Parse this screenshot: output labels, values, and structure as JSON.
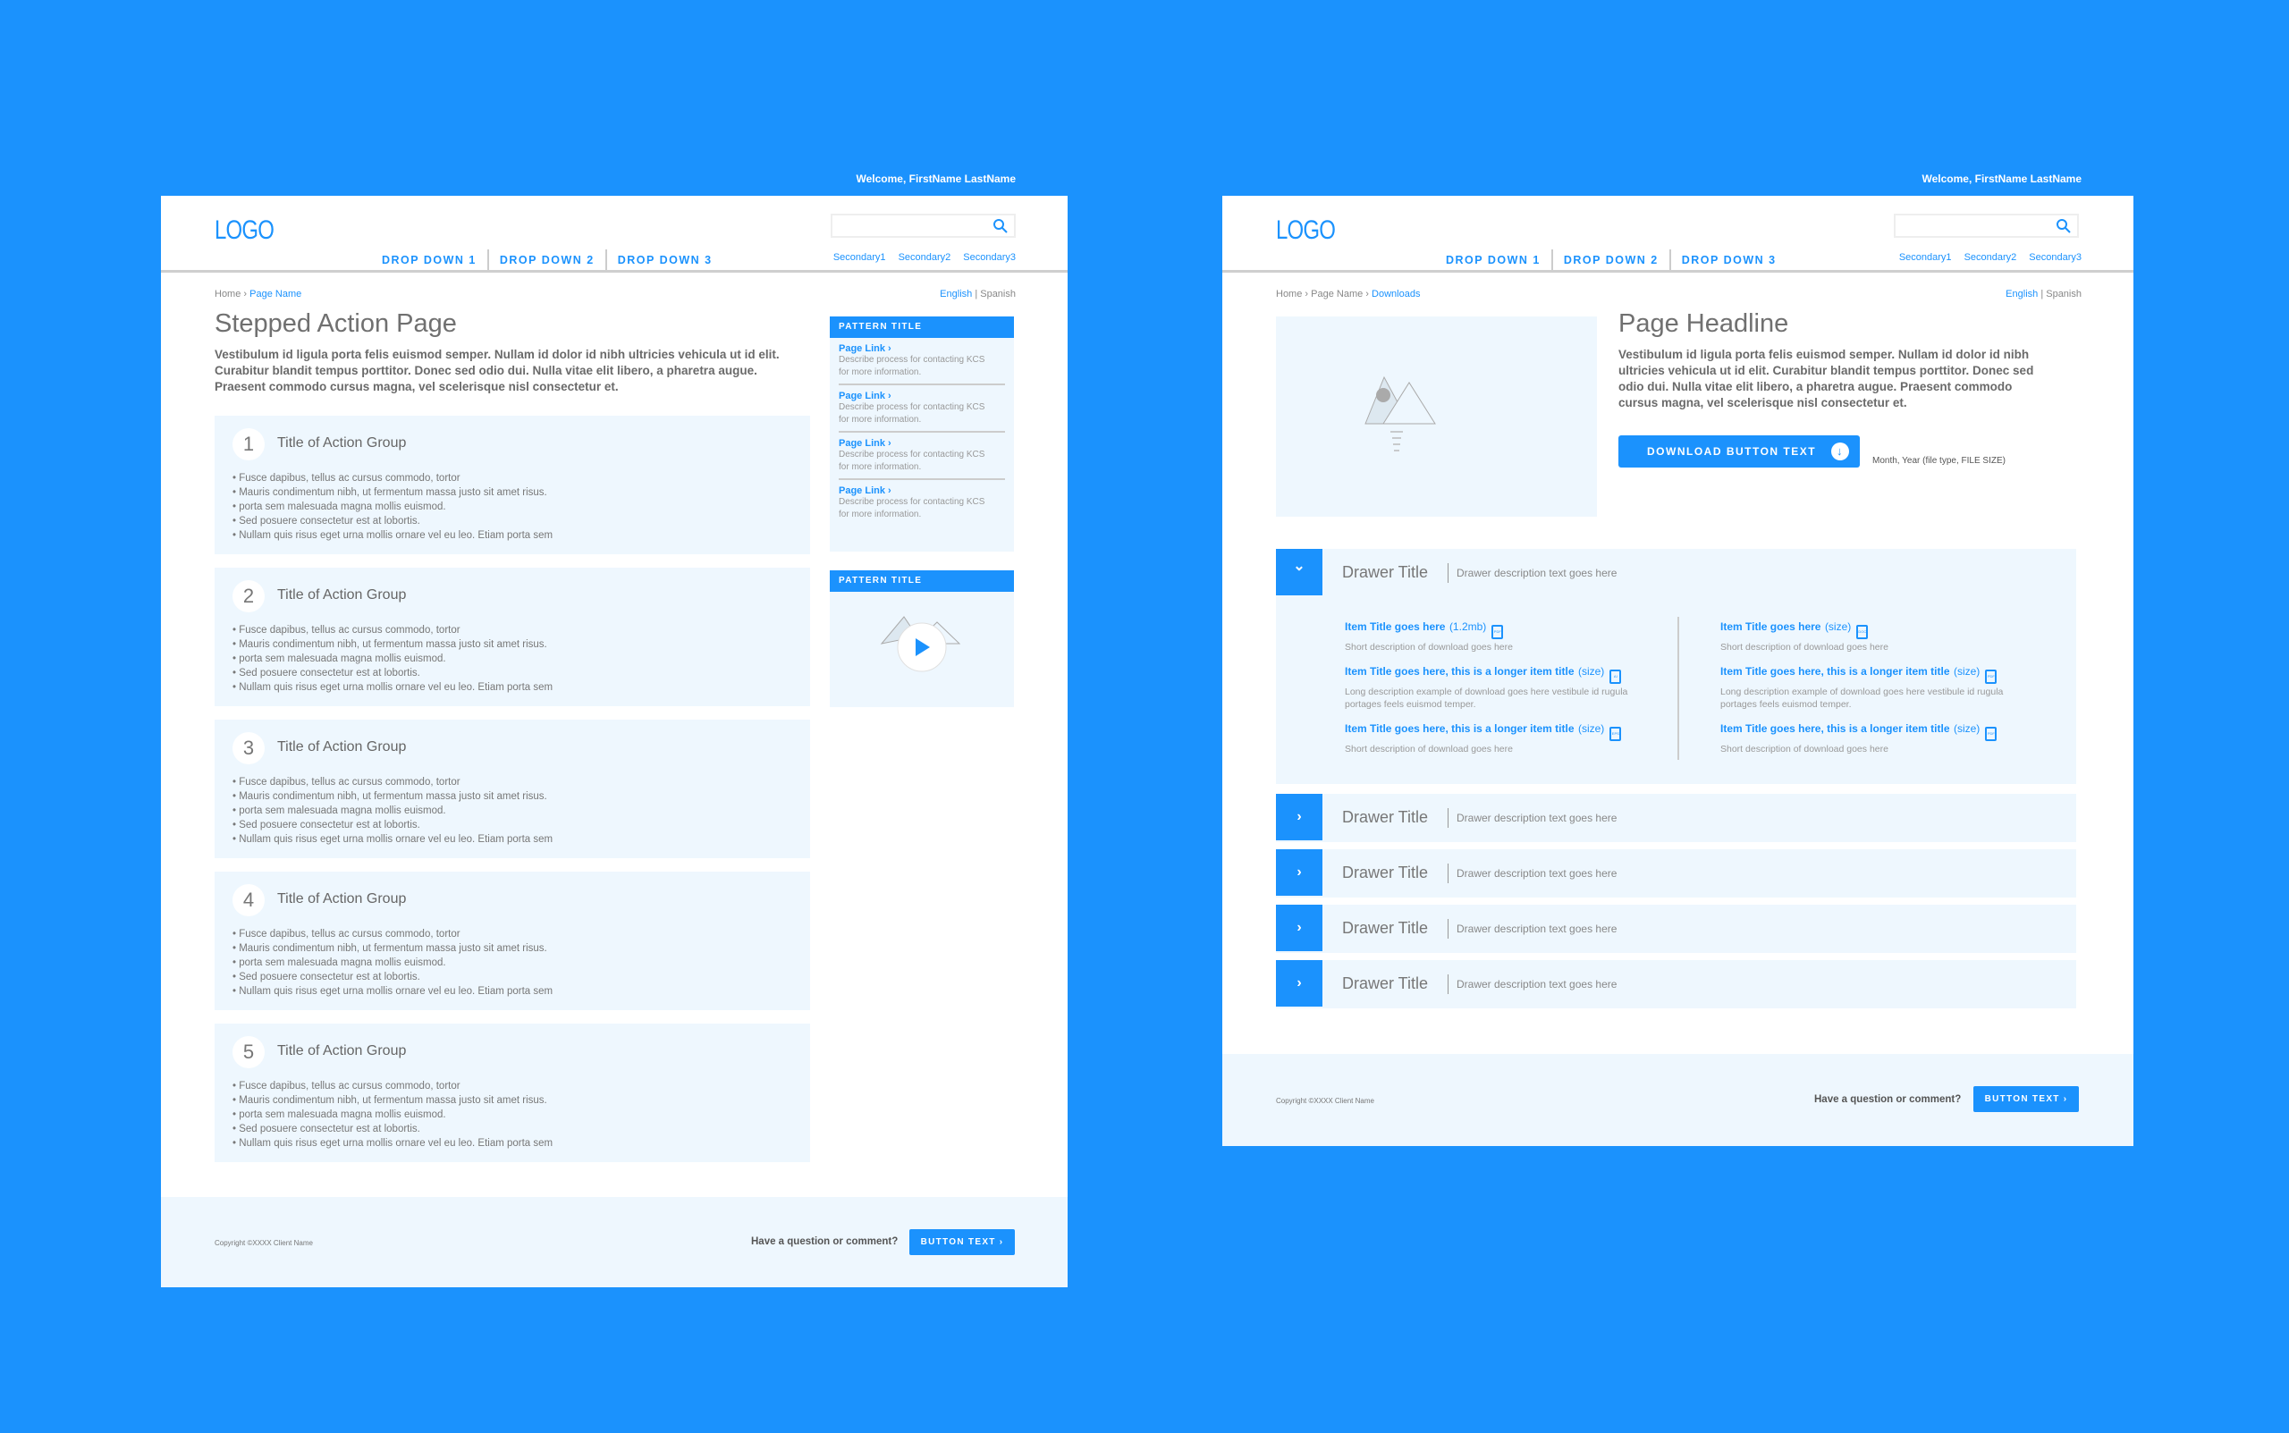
{
  "colors": {
    "accent": "#1b92fd",
    "panel": "#eef7fe"
  },
  "header": {
    "welcome": "Welcome, FirstName LastName",
    "logo": "LOGO",
    "nav": [
      "DROP DOWN 1",
      "DROP DOWN 2",
      "DROP DOWN 3"
    ],
    "secondary": [
      "Secondary1",
      "Secondary2",
      "Secondary3"
    ],
    "search_icon": "search-icon",
    "lang": {
      "english": "English",
      "sep": "|",
      "spanish": "Spanish"
    }
  },
  "left": {
    "breadcrumb": {
      "home": "Home",
      "sep": "›",
      "current": "Page Name"
    },
    "title": "Stepped Action Page",
    "intro": [
      "Vestibulum id ligula porta felis euismod semper. Nullam id dolor id nibh ultricies vehicula ut id elit.",
      "Curabitur blandit tempus porttitor. Donec sed odio dui. Nulla vitae elit libero, a pharetra augue.",
      "Praesent commodo cursus magna, vel scelerisque nisl consectetur et."
    ],
    "groups": [
      {
        "num": "1",
        "title": "Title of Action Group"
      },
      {
        "num": "2",
        "title": "Title of Action Group"
      },
      {
        "num": "3",
        "title": "Title of Action Group"
      },
      {
        "num": "4",
        "title": "Title of Action Group"
      },
      {
        "num": "5",
        "title": "Title of Action Group"
      }
    ],
    "group_bullets": [
      "• Fusce dapibus, tellus ac cursus commodo, tortor",
      "• Mauris condimentum nibh, ut fermentum massa justo sit amet risus.",
      "• porta sem malesuada magna mollis euismod.",
      "• Sed posuere consectetur est at lobortis.",
      "• Nullam quis risus eget urna mollis ornare vel eu leo. Etiam porta sem"
    ],
    "pattern1": {
      "title": "PATTERN TITLE",
      "links": [
        {
          "label": "Page Link ›",
          "desc": "Describe process for contacting KCS for more information."
        },
        {
          "label": "Page Link ›",
          "desc": "Describe process for contacting KCS for more information."
        },
        {
          "label": "Page Link ›",
          "desc": "Describe process for contacting KCS for more information."
        },
        {
          "label": "Page Link ›",
          "desc": "Describe process for contacting KCS for more information."
        }
      ]
    },
    "pattern2": {
      "title": "PATTERN TITLE",
      "icon": "play-icon"
    },
    "footer": {
      "copyright": "Copyright ©XXXX Client Name",
      "question": "Have a question or comment?",
      "button": "BUTTON TEXT ›"
    }
  },
  "right": {
    "breadcrumb": {
      "home": "Home",
      "sep": "›",
      "parent": "Page Name",
      "current": "Downloads"
    },
    "title": "Page Headline",
    "intro": [
      "Vestibulum id ligula porta felis euismod semper. Nullam id dolor id nibh",
      "ultricies vehicula ut id elit. Curabitur blandit tempus porttitor. Donec sed",
      "odio dui. Nulla vitae elit libero, a pharetra augue. Praesent commodo",
      "cursus magna, vel scelerisque nisl consectetur et."
    ],
    "download": {
      "label": "DOWNLOAD BUTTON TEXT",
      "icon": "download-icon",
      "meta": "Month, Year (file type, FILE SIZE)"
    },
    "drawers": [
      {
        "title": "Drawer Title",
        "desc": "Drawer description text goes here",
        "open": true
      },
      {
        "title": "Drawer Title",
        "desc": "Drawer description text goes here",
        "open": false
      },
      {
        "title": "Drawer Title",
        "desc": "Drawer description text goes here",
        "open": false
      },
      {
        "title": "Drawer Title",
        "desc": "Drawer description text goes here",
        "open": false
      },
      {
        "title": "Drawer Title",
        "desc": "Drawer description text goes here",
        "open": false
      }
    ],
    "items": [
      {
        "title": "Item Title goes here",
        "size": "(1.2mb)",
        "type": "PDF",
        "desc": "Short description of download goes here"
      },
      {
        "title": "Item Title goes here, this is a longer item title",
        "size": "(size)",
        "type": "AI",
        "desc": "Long description example of download goes here vestibule id rugula portages feels euismod temper."
      },
      {
        "title": "Item Title goes here, this is a longer item title",
        "size": "(size)",
        "type": "EPS",
        "desc": "Short description of download goes here"
      },
      {
        "title": "Item Title goes here",
        "size": "(size)",
        "type": "DOC",
        "desc": "Short description of download goes here"
      },
      {
        "title": "Item Title goes here, this is a longer item title",
        "size": "(size)",
        "type": "PDF",
        "desc": "Long description example of download goes here vestibule id rugula portages feels euismod temper."
      },
      {
        "title": "Item Title goes here, this is a longer item title",
        "size": "(size)",
        "type": "PDF",
        "desc": "Short description of download goes here"
      }
    ],
    "footer": {
      "copyright": "Copyright ©XXXX Client Name",
      "question": "Have a question or comment?",
      "button": "BUTTON TEXT ›"
    }
  }
}
